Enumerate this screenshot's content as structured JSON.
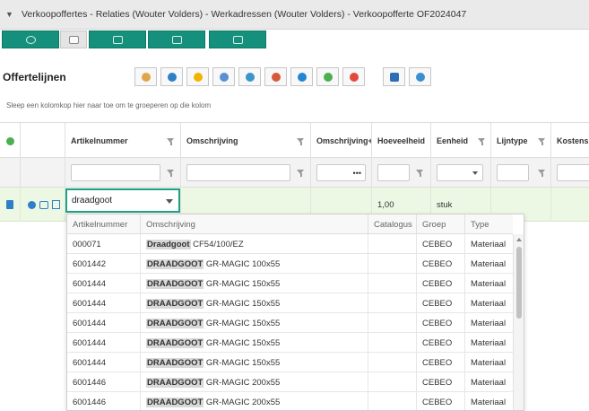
{
  "window": {
    "breadcrumb": "Verkoopoffertes - Relaties (Wouter Volders) - Werkadressen (Wouter Volders) - Verkoopofferte OF2024047"
  },
  "nav": {
    "buttons": [
      "layout-icon",
      "page-icon",
      "image-icon",
      "print-icon",
      "card-icon"
    ]
  },
  "section": {
    "title": "Offertelijnen"
  },
  "toolbar": {
    "icons": [
      "hand-icon",
      "search-icon",
      "coin-icon",
      "users-icon",
      "refresh-icon",
      "transfer-icon",
      "back-icon",
      "plus-icon",
      "stop-icon",
      "save-icon",
      "undo-icon"
    ]
  },
  "hint": "Sleep een kolomkop hier naar toe om te groeperen op die kolom",
  "columns": [
    {
      "label": ""
    },
    {
      "label": ""
    },
    {
      "label": "Artikelnummer"
    },
    {
      "label": "Omschrijving"
    },
    {
      "label": "Omschrijving+"
    },
    {
      "label": "Hoeveelheid"
    },
    {
      "label": "Eenheid"
    },
    {
      "label": "Lijntype"
    },
    {
      "label": "Kostens"
    }
  ],
  "filters": {
    "omschrijving_plus": "•••"
  },
  "row": {
    "artikelnummer": "draadgoot",
    "hoeveelheid": "1,00",
    "eenheid": "stuk"
  },
  "dropdown": {
    "headers": [
      "Artikelnummer",
      "Omschrijving",
      "Catalogus",
      "Groep",
      "Type"
    ],
    "rows": [
      {
        "nr": "000071",
        "hl": "Draadgoot",
        "rest": " CF54/100/EZ",
        "cat": "",
        "groep": "CEBEO",
        "type": "Materiaal"
      },
      {
        "nr": "6001442",
        "hl": "DRAADGOOT",
        "rest": " GR-MAGIC 100x55",
        "cat": "",
        "groep": "CEBEO",
        "type": "Materiaal"
      },
      {
        "nr": "6001444",
        "hl": "DRAADGOOT",
        "rest": " GR-MAGIC 150x55",
        "cat": "",
        "groep": "CEBEO",
        "type": "Materiaal"
      },
      {
        "nr": "6001444",
        "hl": "DRAADGOOT",
        "rest": " GR-MAGIC 150x55",
        "cat": "",
        "groep": "CEBEO",
        "type": "Materiaal"
      },
      {
        "nr": "6001444",
        "hl": "DRAADGOOT",
        "rest": " GR-MAGIC 150x55",
        "cat": "",
        "groep": "CEBEO",
        "type": "Materiaal"
      },
      {
        "nr": "6001444",
        "hl": "DRAADGOOT",
        "rest": " GR-MAGIC 150x55",
        "cat": "",
        "groep": "CEBEO",
        "type": "Materiaal"
      },
      {
        "nr": "6001444",
        "hl": "DRAADGOOT",
        "rest": " GR-MAGIC 150x55",
        "cat": "",
        "groep": "CEBEO",
        "type": "Materiaal"
      },
      {
        "nr": "6001446",
        "hl": "DRAADGOOT",
        "rest": " GR-MAGIC 200x55",
        "cat": "",
        "groep": "CEBEO",
        "type": "Materiaal"
      },
      {
        "nr": "6001446",
        "hl": "DRAADGOOT",
        "rest": " GR-MAGIC 200x55",
        "cat": "",
        "groep": "CEBEO",
        "type": "Materiaal"
      }
    ]
  },
  "colors": {
    "accent": "#15907c",
    "row_highlight": "#ecf7e4"
  }
}
